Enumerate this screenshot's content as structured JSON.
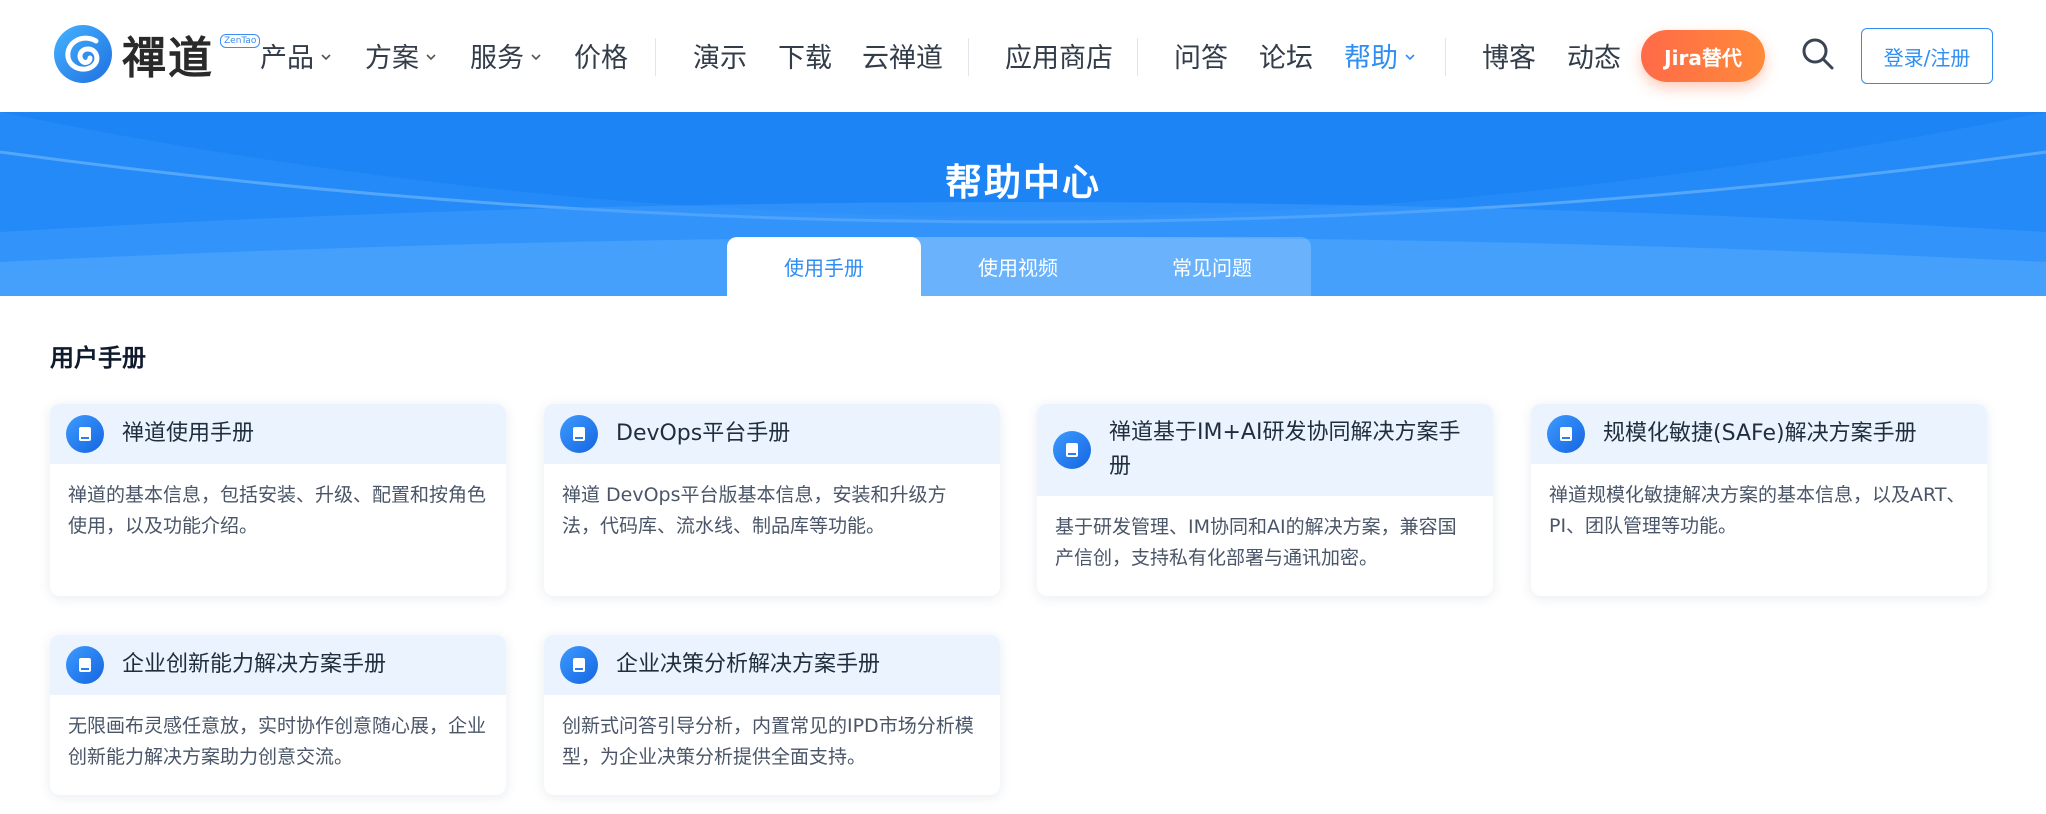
{
  "brand": {
    "name": "禪道",
    "tag": "ZenTao",
    "accent": "#2f8ef4"
  },
  "nav": {
    "items": [
      {
        "label": "产品",
        "dropdown": true
      },
      {
        "label": "方案",
        "dropdown": true
      },
      {
        "label": "服务",
        "dropdown": true
      },
      {
        "label": "价格",
        "dropdown": false
      },
      {
        "label": "演示",
        "dropdown": false
      },
      {
        "label": "下载",
        "dropdown": false
      },
      {
        "label": "云禅道",
        "dropdown": false
      },
      {
        "label": "应用商店",
        "dropdown": false
      },
      {
        "label": "问答",
        "dropdown": false
      },
      {
        "label": "论坛",
        "dropdown": false
      },
      {
        "label": "帮助",
        "dropdown": true,
        "active": true
      },
      {
        "label": "博客",
        "dropdown": false
      },
      {
        "label": "动态",
        "dropdown": false
      }
    ],
    "jira_button": "Jira替代",
    "search_icon": "search-icon",
    "login_button": "登录/注册"
  },
  "banner": {
    "title": "帮助中心",
    "tabs": [
      {
        "label": "使用手册",
        "active": true
      },
      {
        "label": "使用视频",
        "active": false
      },
      {
        "label": "常见问题",
        "active": false
      }
    ]
  },
  "section": {
    "title": "用户手册",
    "cards": [
      {
        "title": "禅道使用手册",
        "desc": "禅道的基本信息，包括安装、升级、配置和按角色使用，以及功能介绍。"
      },
      {
        "title": "DevOps平台手册",
        "desc": "禅道 DevOps平台版基本信息，安装和升级方法，代码库、流水线、制品库等功能。"
      },
      {
        "title": "禅道基于IM+AI研发协同解决方案手册",
        "desc": "基于研发管理、IM协同和AI的解决方案，兼容国产信创，支持私有化部署与通讯加密。"
      },
      {
        "title": "规模化敏捷(SAFe)解决方案手册",
        "desc": "禅道规模化敏捷解决方案的基本信息，以及ART、PI、团队管理等功能。"
      },
      {
        "title": "企业创新能力解决方案手册",
        "desc": "无限画布灵感任意放，实时协作创意随心展，企业创新能力解决方案助力创意交流。"
      },
      {
        "title": "企业决策分析解决方案手册",
        "desc": "创新式问答引导分析，内置常见的IPD市场分析模型，为企业决策分析提供全面支持。"
      }
    ]
  }
}
